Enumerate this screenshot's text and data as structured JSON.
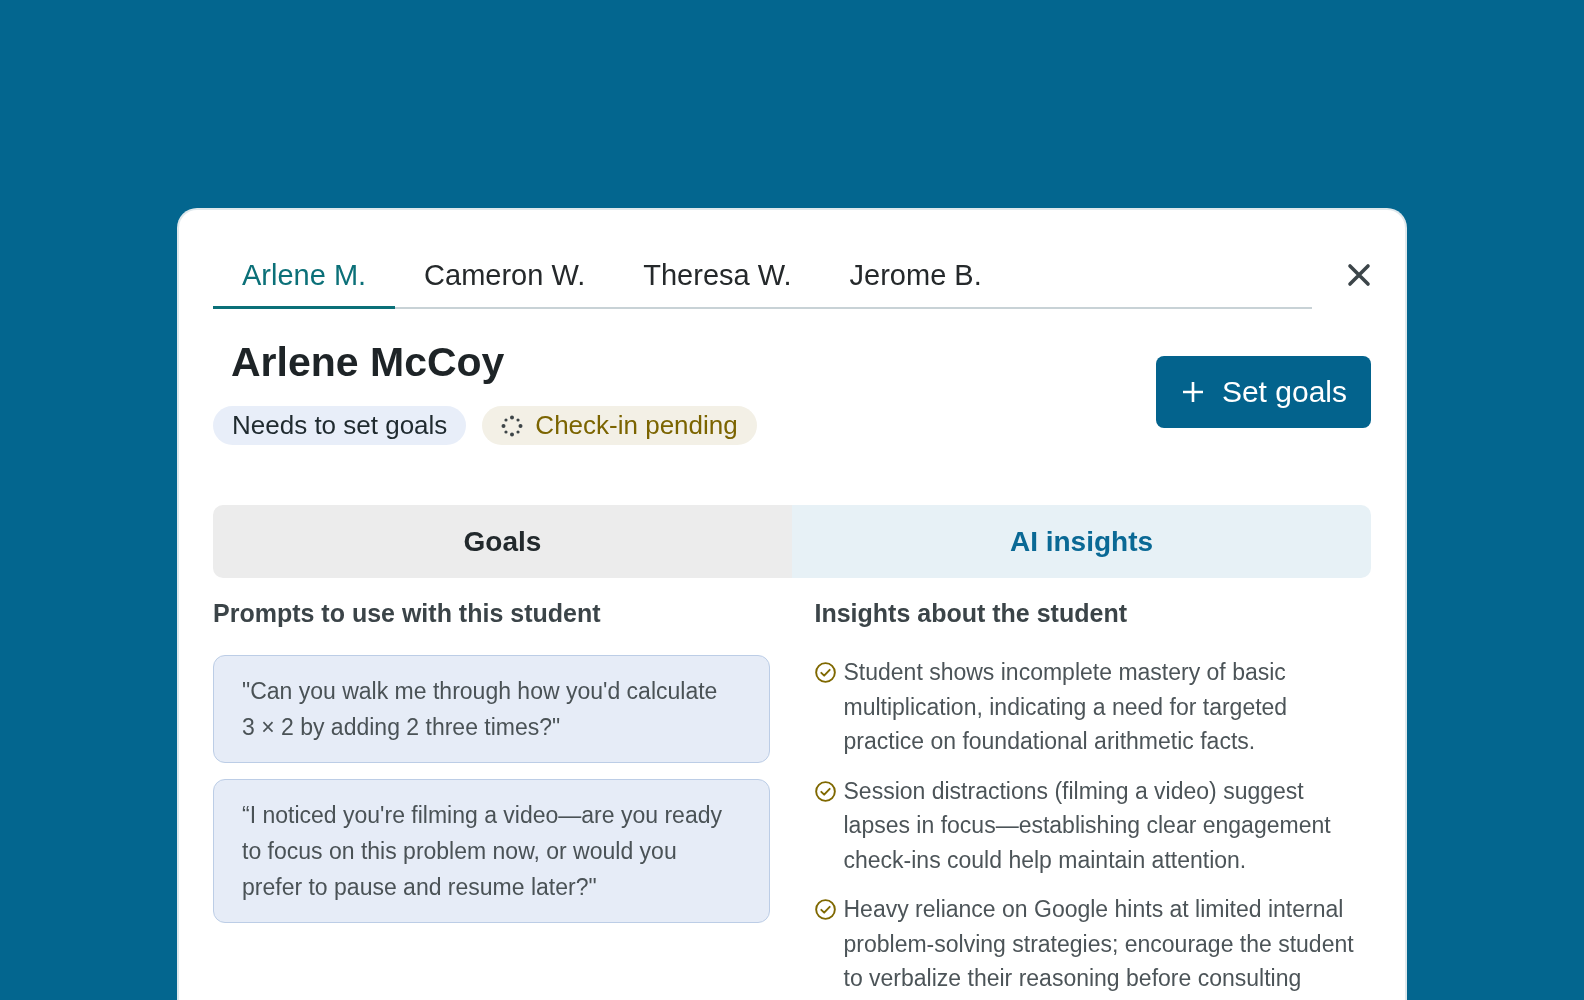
{
  "student_tabs": [
    {
      "label": "Arlene M.",
      "selected": true
    },
    {
      "label": "Cameron W.",
      "selected": false
    },
    {
      "label": "Theresa W.",
      "selected": false
    },
    {
      "label": "Jerome B.",
      "selected": false
    }
  ],
  "student": {
    "name": "Arlene McCoy",
    "badges": [
      {
        "label": "Needs to set goals",
        "kind": "info"
      },
      {
        "label": "Check-in pending",
        "kind": "pending"
      }
    ]
  },
  "primary_button": {
    "label": "Set goals"
  },
  "view_tabs": [
    {
      "label": "Goals",
      "selected": false
    },
    {
      "label": "AI insights",
      "selected": true
    }
  ],
  "prompts": {
    "heading": "Prompts to use with this student",
    "items": [
      "\"Can you walk me through how you'd calculate 3 × 2 by adding 2 three times?\"",
      "“I noticed you're filming a video—are you ready to focus on this problem now, or would you prefer to pause and resume later?\""
    ]
  },
  "insights": {
    "heading": "Insights about the student",
    "items": [
      "Student shows incomplete mastery of basic multiplication, indicating a need for targeted practice on foundational arithmetic facts.",
      "Session distractions (filming a video) suggest lapses in focus—establishing clear engagement check-ins could help maintain attention.",
      "Heavy reliance on Google hints at limited internal problem-solving strategies; encourage the student to verbalize their reasoning before consulting"
    ]
  }
}
